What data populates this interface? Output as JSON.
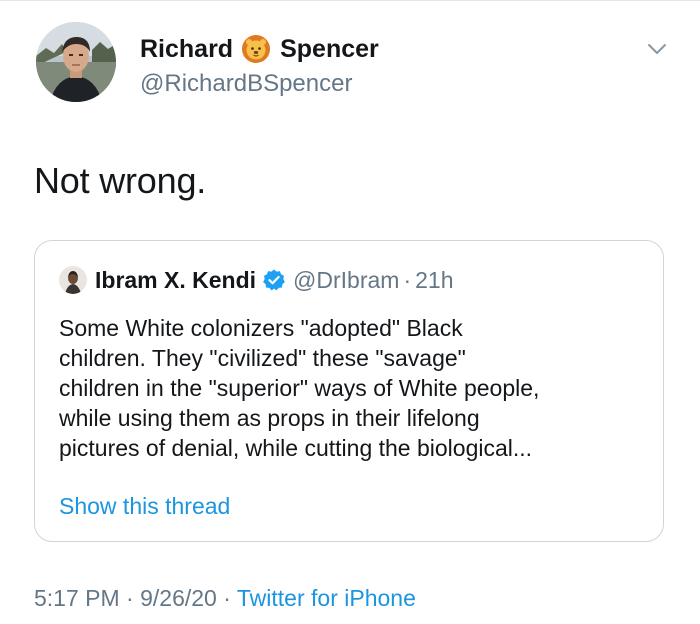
{
  "author": {
    "first_name": "Richard",
    "last_name": "Spencer",
    "handle": "@RichardBSpencer",
    "name_emoji": "lion-face-icon"
  },
  "tweet": {
    "text": "Not wrong."
  },
  "quoted_tweet": {
    "author_name": "Ibram X. Kendi",
    "verified": true,
    "handle": "@DrIbram",
    "separator": "·",
    "time_ago": "21h",
    "text_lines": [
      "Some White colonizers \"adopted\" Black",
      "children. They \"civilized\" these \"savage\"",
      "children in the \"superior\" ways of White people,",
      "while using them as props in their lifelong",
      "pictures of denial, while cutting the biological..."
    ],
    "show_thread_label": "Show this thread"
  },
  "meta": {
    "time": "5:17 PM",
    "separator": "·",
    "date": "9/26/20",
    "source": "Twitter for iPhone"
  },
  "colors": {
    "text": "#14171a",
    "secondary": "#657786",
    "link": "#1b95e0",
    "verified": "#1da1f2",
    "border": "#ccd6dd"
  }
}
